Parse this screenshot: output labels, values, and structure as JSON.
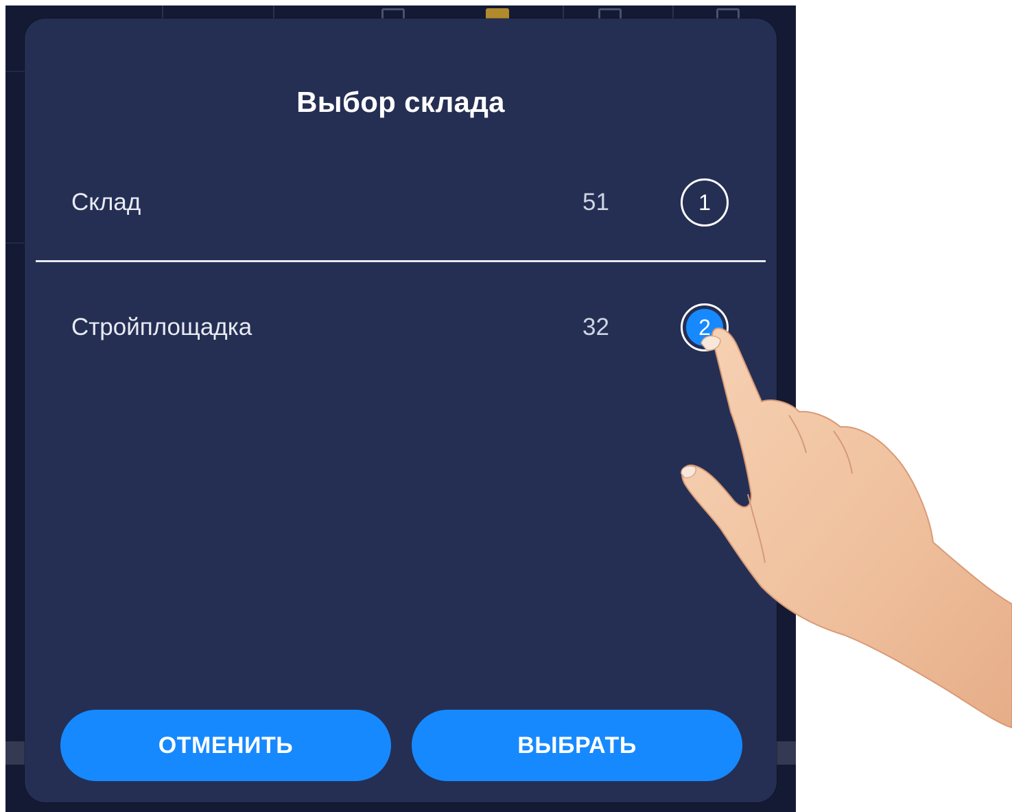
{
  "dialog": {
    "title": "Выбор склада",
    "items": [
      {
        "name": "Склад",
        "count": "51",
        "number": "1",
        "selected": false
      },
      {
        "name": "Стройплощадка",
        "count": "32",
        "number": "2",
        "selected": true
      }
    ],
    "buttons": {
      "cancel": "ОТМЕНИТЬ",
      "select": "ВЫБРАТЬ"
    }
  },
  "colors": {
    "dialog_bg": "#252f54",
    "accent": "#1689ff",
    "backdrop": "#141a33"
  },
  "icons": [
    "toolbar-document-icon",
    "toolbar-folder-icon",
    "toolbar-layout-icon",
    "toolbar-box-icon",
    "pointing-hand-illustration"
  ]
}
